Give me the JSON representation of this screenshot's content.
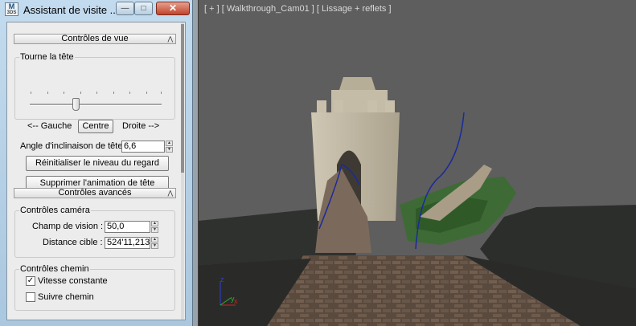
{
  "window": {
    "app_icon": "3ds-max-icon",
    "app_icon_top": "M",
    "app_icon_bottom": "3DS",
    "title": "Assistant de visite ...",
    "minimize_glyph": "—",
    "maximize_glyph": "□",
    "close_glyph": "✕"
  },
  "view_controls": {
    "header": "Contrôles de vue",
    "collapse_glyph": "⋀",
    "turn_head_group": "Tourne la tête",
    "left_label": "<-- Gauche",
    "center_button": "Centre",
    "right_label": "Droite -->",
    "slider_position": 0.35,
    "tilt_label": "Angle d'inclinaison de tête",
    "tilt_value": "6,6",
    "reset_button": "Réinitialiser le niveau du regard",
    "delete_anim_button": "Supprimer l'animation de tête"
  },
  "advanced_controls": {
    "header": "Contrôles avancés",
    "collapse_glyph": "⋀",
    "camera_group": "Contrôles caméra",
    "fov_label": "Champ de vision :",
    "fov_value": "50,0",
    "target_label": "Distance cible :",
    "target_value": "524'11,213",
    "path_group": "Contrôles chemin",
    "constant_speed_label": "Vitesse constante",
    "constant_speed_checked": true,
    "follow_path_label": "Suivre chemin",
    "follow_path_checked": false,
    "check_glyph": "✓",
    "spin_up": "▲",
    "spin_down": "▼"
  },
  "viewport": {
    "label": "[ + ] [ Walkthrough_Cam01 ] [ Lissage + reflets ]",
    "axis_x": "x",
    "axis_y": "y",
    "axis_z": "z",
    "background": "#5e5e5e"
  }
}
